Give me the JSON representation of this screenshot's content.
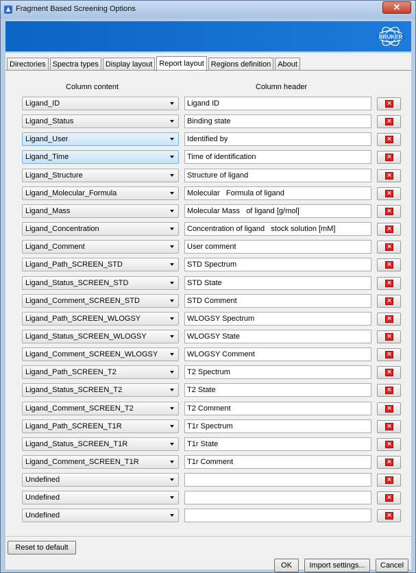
{
  "window": {
    "title": "Fragment Based Screening Options",
    "close_label": "✕"
  },
  "banner": {
    "logo_text": "BRUKER"
  },
  "tabs": [
    {
      "label": "Directories",
      "active": false
    },
    {
      "label": "Spectra types",
      "active": false
    },
    {
      "label": "Display layout",
      "active": false
    },
    {
      "label": "Report layout",
      "active": true
    },
    {
      "label": "Regions definition",
      "active": false
    },
    {
      "label": "About",
      "active": false
    }
  ],
  "columns": {
    "content_header": "Column content",
    "header_header": "Column header"
  },
  "rows": [
    {
      "content": "Ligand_ID",
      "header": "Ligand ID",
      "highlight": false
    },
    {
      "content": "Ligand_Status",
      "header": "Binding state",
      "highlight": false
    },
    {
      "content": "Ligand_User",
      "header": "Identified by",
      "highlight": true
    },
    {
      "content": "Ligand_Time",
      "header": "Time of identification",
      "highlight": true
    },
    {
      "content": "Ligand_Structure",
      "header": "Structure of ligand",
      "highlight": false
    },
    {
      "content": "Ligand_Molecular_Formula",
      "header": "Molecular   Formula of ligand",
      "highlight": false
    },
    {
      "content": "Ligand_Mass",
      "header": "Molecular Mass   of ligand [g/mol]",
      "highlight": false
    },
    {
      "content": "Ligand_Concentration",
      "header": "Concentration of ligand   stock solution [mM]",
      "highlight": false
    },
    {
      "content": "Ligand_Comment",
      "header": "User comment",
      "highlight": false
    },
    {
      "content": "Ligand_Path_SCREEN_STD",
      "header": "STD Spectrum",
      "highlight": false
    },
    {
      "content": "Ligand_Status_SCREEN_STD",
      "header": "STD State",
      "highlight": false
    },
    {
      "content": "Ligand_Comment_SCREEN_STD",
      "header": "STD Comment",
      "highlight": false
    },
    {
      "content": "Ligand_Path_SCREEN_WLOGSY",
      "header": "WLOGSY Spectrum",
      "highlight": false
    },
    {
      "content": "Ligand_Status_SCREEN_WLOGSY",
      "header": "WLOGSY State",
      "highlight": false
    },
    {
      "content": "Ligand_Comment_SCREEN_WLOGSY",
      "header": "WLOGSY Comment",
      "highlight": false
    },
    {
      "content": "Ligand_Path_SCREEN_T2",
      "header": "T2 Spectrum",
      "highlight": false
    },
    {
      "content": "Ligand_Status_SCREEN_T2",
      "header": "T2 State",
      "highlight": false
    },
    {
      "content": "Ligand_Comment_SCREEN_T2",
      "header": "T2 Comment",
      "highlight": false
    },
    {
      "content": "Ligand_Path_SCREEN_T1R",
      "header": "T1r Spectrum",
      "highlight": false
    },
    {
      "content": "Ligand_Status_SCREEN_T1R",
      "header": "T1r State",
      "highlight": false
    },
    {
      "content": "Ligand_Comment_SCREEN_T1R",
      "header": "T1r Comment",
      "highlight": false
    },
    {
      "content": "Undefined",
      "header": "",
      "highlight": false
    },
    {
      "content": "Undefined",
      "header": "",
      "highlight": false
    },
    {
      "content": "Undefined",
      "header": "",
      "highlight": false
    }
  ],
  "delete_icon": "delete-x-icon",
  "buttons": {
    "reset": "Reset to default",
    "ok": "OK",
    "import": "Import settings...",
    "cancel": "Cancel"
  },
  "colors": {
    "banner": "#0c64c4",
    "delete": "#e0201c",
    "highlight": "#c9e3f9"
  }
}
